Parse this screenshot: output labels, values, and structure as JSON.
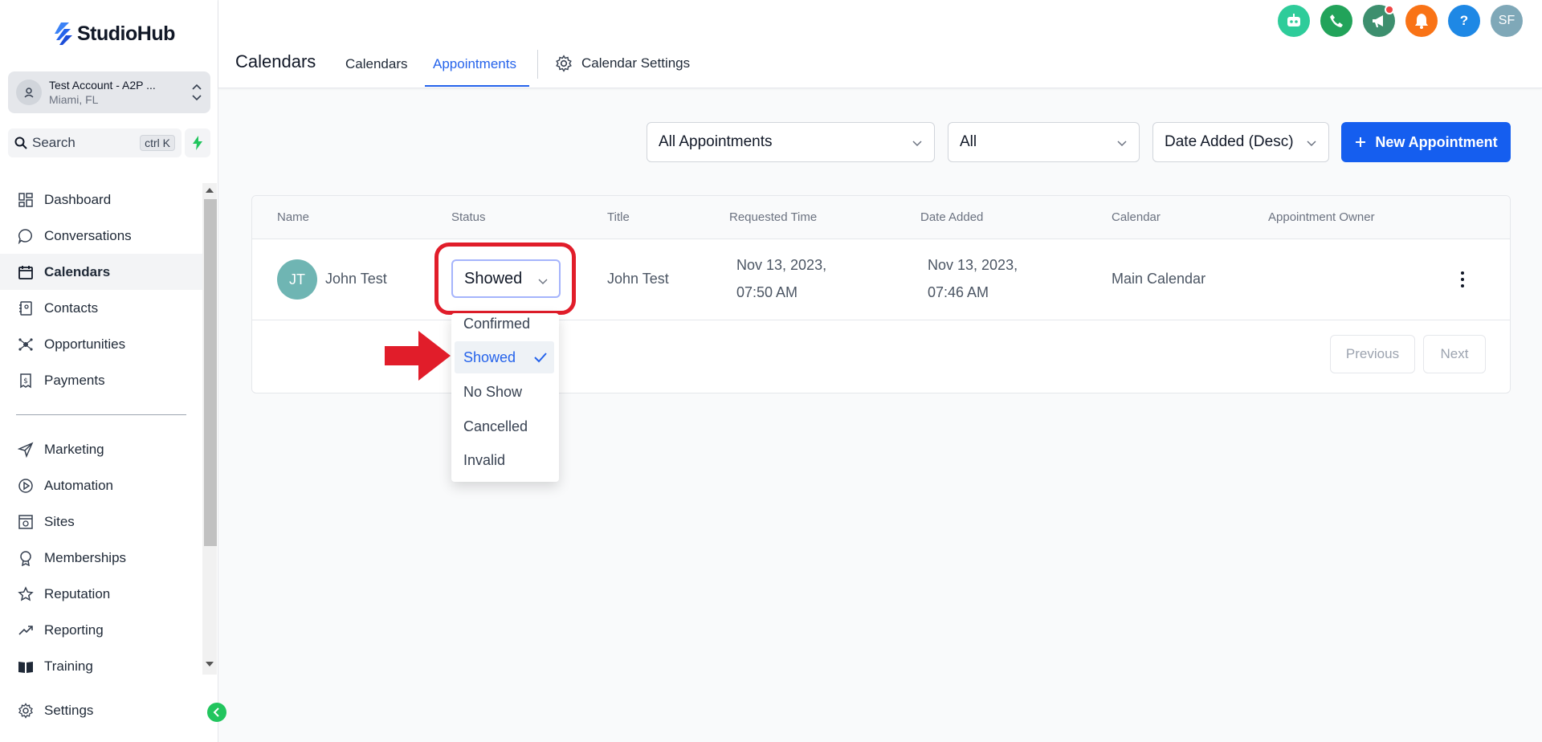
{
  "brand": {
    "name": "StudioHub"
  },
  "account": {
    "name": "Test Account - A2P ...",
    "location": "Miami, FL"
  },
  "search": {
    "label": "Search",
    "shortcut": "ctrl K"
  },
  "sidebar": {
    "items": [
      {
        "label": "Dashboard",
        "icon": "dashboard-icon"
      },
      {
        "label": "Conversations",
        "icon": "chat-icon"
      },
      {
        "label": "Calendars",
        "icon": "calendar-icon",
        "active": true
      },
      {
        "label": "Contacts",
        "icon": "contacts-icon"
      },
      {
        "label": "Opportunities",
        "icon": "opportunities-icon"
      },
      {
        "label": "Payments",
        "icon": "payments-icon"
      }
    ],
    "items2": [
      {
        "label": "Marketing",
        "icon": "send-icon"
      },
      {
        "label": "Automation",
        "icon": "automation-icon"
      },
      {
        "label": "Sites",
        "icon": "sites-icon"
      },
      {
        "label": "Memberships",
        "icon": "award-icon"
      },
      {
        "label": "Reputation",
        "icon": "star-icon"
      },
      {
        "label": "Reporting",
        "icon": "trend-icon"
      },
      {
        "label": "Training",
        "icon": "book-icon"
      }
    ],
    "settings": "Settings"
  },
  "header": {
    "title": "Calendars",
    "tabs": [
      "Calendars",
      "Appointments",
      "Calendar Settings"
    ],
    "active_tab": "Appointments",
    "user_initials": "SF",
    "help": "?",
    "icon_colors": [
      "#2ecc9a",
      "#22a35a",
      "#3d8f6e",
      "#f97316",
      "#1e88e5",
      "#7fa8b8"
    ]
  },
  "filters": {
    "appointments": "All Appointments",
    "calendar": "All",
    "sort": "Date Added (Desc)",
    "new_button": "New Appointment"
  },
  "table": {
    "columns": [
      "Name",
      "Status",
      "Title",
      "Requested Time",
      "Date Added",
      "Calendar",
      "Appointment Owner"
    ],
    "rows": [
      {
        "initials": "JT",
        "name": "John Test",
        "status": "Showed",
        "title": "John Test",
        "requested_date": "Nov 13, 2023,",
        "requested_time": "07:50 AM",
        "added_date": "Nov 13, 2023,",
        "added_time": "07:46 AM",
        "calendar": "Main Calendar",
        "owner": ""
      }
    ],
    "pagination": {
      "previous": "Previous",
      "next": "Next"
    }
  },
  "status_dropdown": {
    "options": [
      "Confirmed",
      "Showed",
      "No Show",
      "Cancelled",
      "Invalid"
    ],
    "selected": "Showed"
  },
  "colors": {
    "primary": "#155eef",
    "annotation": "#e11d2a",
    "avatar": "#6fb5b3"
  }
}
